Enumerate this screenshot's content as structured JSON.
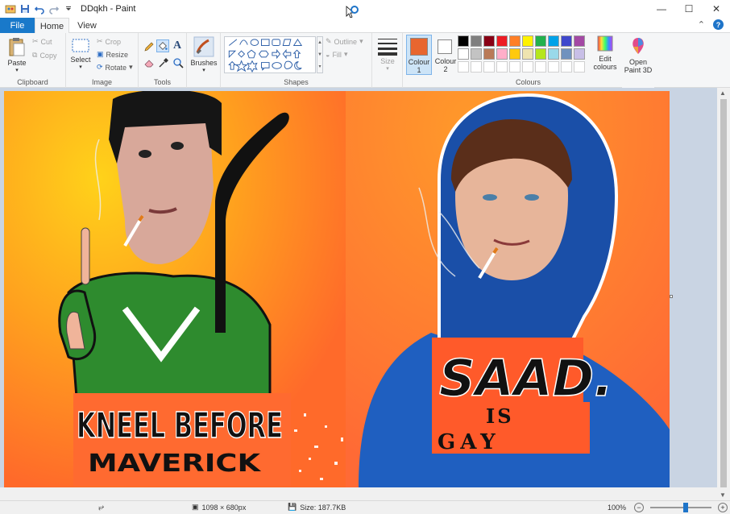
{
  "window": {
    "title": "DDqkh - Paint"
  },
  "tabs": {
    "file": "File",
    "home": "Home",
    "view": "View"
  },
  "clipboard": {
    "paste": "Paste",
    "cut": "Cut",
    "copy": "Copy",
    "label": "Clipboard"
  },
  "image": {
    "select": "Select",
    "crop": "Crop",
    "resize": "Resize",
    "rotate": "Rotate",
    "label": "Image"
  },
  "tools": {
    "label": "Tools"
  },
  "brushes": {
    "label": "Brushes"
  },
  "shapes": {
    "outline": "Outline",
    "fill": "Fill",
    "label": "Shapes"
  },
  "size": {
    "label": "Size"
  },
  "colours": {
    "colour1": "Colour 1",
    "colour2": "Colour 2",
    "colour1_line1": "Colour",
    "colour1_line2": "1",
    "colour2_line1": "Colour",
    "colour2_line2": "2",
    "edit_line1": "Edit",
    "edit_line2": "colours",
    "label": "Colours",
    "colour1_value": "#e8662f",
    "colour2_value": "#ffffff",
    "palette_row1": [
      "#000000",
      "#7f7f7f",
      "#880015",
      "#ed1c24",
      "#ff7f27",
      "#fff200",
      "#22b14c",
      "#00a2e8",
      "#3f48cc",
      "#a349a4"
    ],
    "palette_row2": [
      "#ffffff",
      "#c3c3c3",
      "#b97a57",
      "#ffaec9",
      "#ffc90e",
      "#efe4b0",
      "#b5e61d",
      "#99d9ea",
      "#7092be",
      "#c8bfe7"
    ],
    "palette_row3": [
      "#ffffff",
      "#ffffff",
      "#ffffff",
      "#ffffff",
      "#ffffff",
      "#ffffff",
      "#ffffff",
      "#ffffff",
      "#ffffff",
      "#ffffff"
    ]
  },
  "paint3d": {
    "line1": "Open",
    "line2": "Paint 3D"
  },
  "canvas": {
    "left_title": "KNEEL BEFORE",
    "left_subtitle": "MAVERICK",
    "right_title": "SAAD.",
    "right_mid": "IS",
    "right_bottom": "GAY"
  },
  "status": {
    "dimensions": "1098 × 680px",
    "size": "Size: 187.7KB",
    "zoom": "100%"
  }
}
